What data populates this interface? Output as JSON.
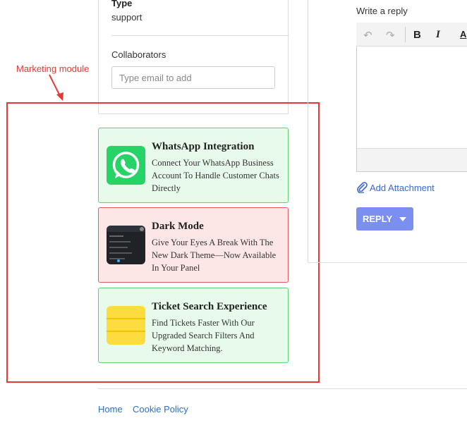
{
  "ticket_info": {
    "type_label": "Type",
    "type_value": "support",
    "collaborators_label": "Collaborators",
    "collaborators_placeholder": "Type email to add"
  },
  "annotation": {
    "label": "Marketing module",
    "color": "#e53935"
  },
  "marketing_cards": [
    {
      "title": "WhatsApp Integration",
      "description": "Connect Your WhatsApp Business Account To Handle Customer Chats Directly",
      "icon": "whatsapp-icon",
      "theme": "green"
    },
    {
      "title": "Dark Mode",
      "description": "Give Your Eyes A Break With The New Dark Theme—Now Available In Your Panel",
      "icon": "dark-mode-preview-icon",
      "theme": "red"
    },
    {
      "title": "Ticket Search Experience",
      "description": "Find Tickets Faster With Our Upgraded Search Filters And Keyword Matching.",
      "icon": "ticket-search-icon",
      "theme": "green"
    }
  ],
  "reply": {
    "label": "Write a reply",
    "toolbar": {
      "undo": "↶",
      "redo": "↷",
      "bold": "B",
      "italic": "I",
      "font": "A"
    },
    "attachment_label": "Add Attachment",
    "button_label": "REPLY",
    "button_color": "#7b8ff0"
  },
  "footer": {
    "links": [
      "Home",
      "Cookie Policy"
    ]
  }
}
